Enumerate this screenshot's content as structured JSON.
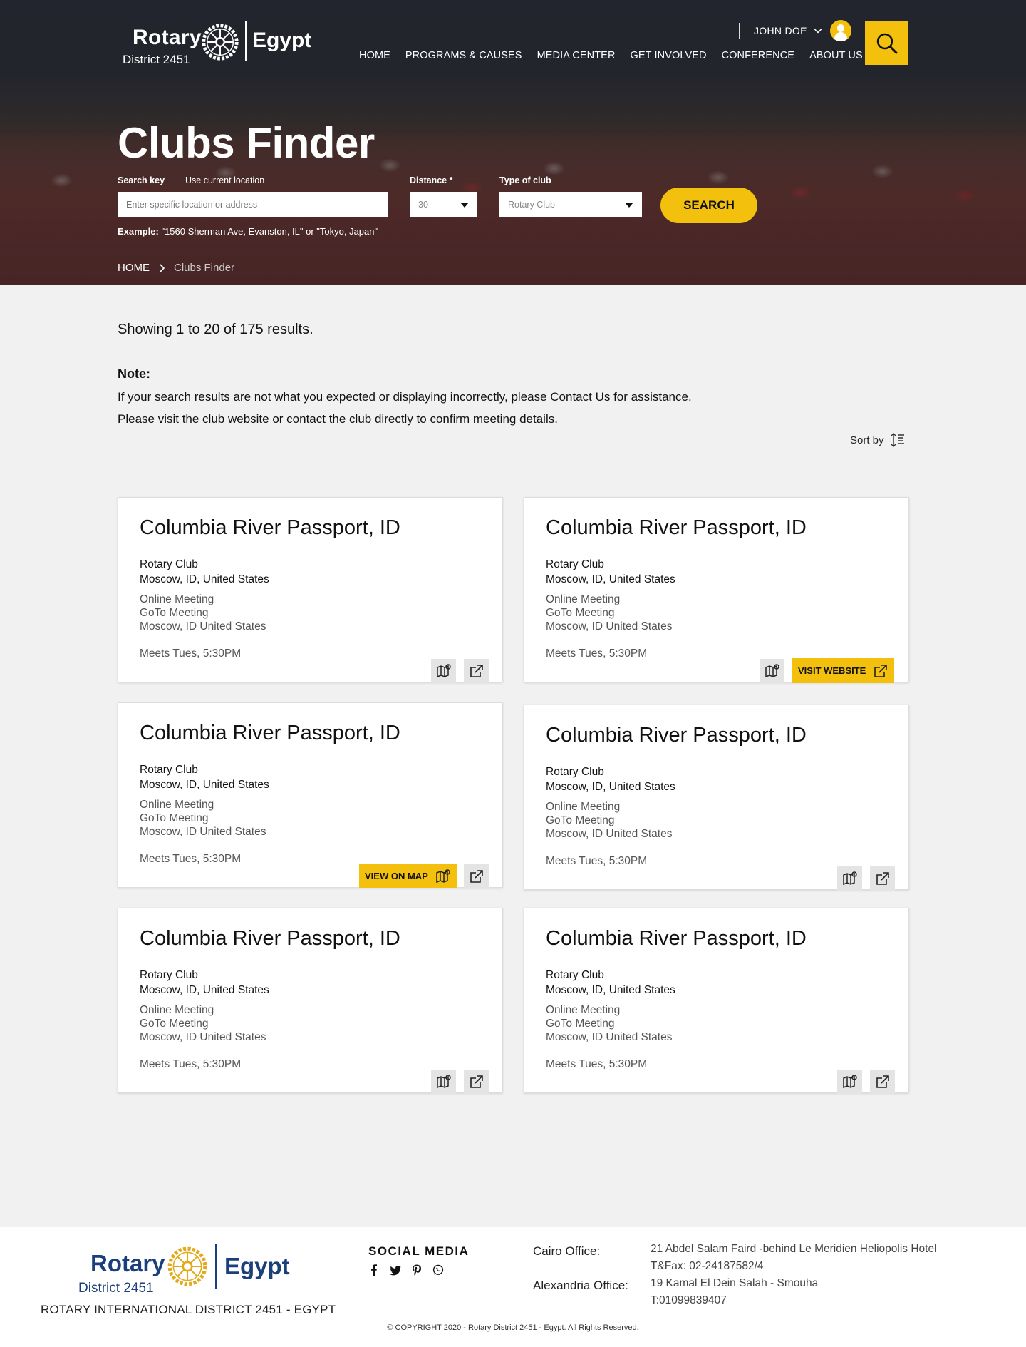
{
  "header": {
    "logo": {
      "rotary": "Rotary",
      "district": "District 2451",
      "country": "Egypt"
    },
    "user_name": "JOHN DOE",
    "nav": [
      "HOME",
      "PROGRAMS & CAUSES",
      "MEDIA CENTER",
      "GET INVOLVED",
      "CONFERENCE",
      "ABOUT US"
    ]
  },
  "hero": {
    "title": "Clubs Finder",
    "search_key_label": "Search key",
    "use_location_label": "Use current location",
    "search_placeholder": "Enter specific location or address",
    "distance_label": "Distance *",
    "distance_value": "30",
    "type_label": "Type of club",
    "type_value": "Rotary Club",
    "search_button": "SEARCH",
    "example_label": "Example:",
    "example_text": "\"1560 Sherman Ave, Evanston, IL\" or \"Tokyo, Japan\""
  },
  "breadcrumb": {
    "home": "HOME",
    "current": "Clubs Finder"
  },
  "results": {
    "showing": "Showing 1 to 20 of 175 results.",
    "note_title": "Note:",
    "note_line1": "If your search results are not what you expected or displaying incorrectly, please Contact Us for assistance.",
    "note_line2": "Please visit the club website or contact the club directly to confirm meeting details.",
    "sort_label": "Sort by"
  },
  "cards": [
    {
      "name": "Columbia River Passport, ID",
      "type": "Rotary Club",
      "location": "Moscow, ID, United States",
      "meeting1": "Online Meeting",
      "meeting2": "GoTo Meeting",
      "meeting3": "Moscow, ID United States",
      "meets": "Meets Tues, 5:30PM"
    },
    {
      "name": "Columbia River Passport, ID",
      "type": "Rotary Club",
      "location": "Moscow, ID, United States",
      "meeting1": "Online Meeting",
      "meeting2": "GoTo Meeting",
      "meeting3": "Moscow, ID United States",
      "meets": "Meets Tues, 5:30PM",
      "visit_label": "VISIT WEBSITE"
    },
    {
      "name": "Columbia River Passport, ID",
      "type": "Rotary Club",
      "location": "Moscow, ID, United States",
      "meeting1": "Online Meeting",
      "meeting2": "GoTo Meeting",
      "meeting3": "Moscow, ID United States",
      "meets": "Meets Tues, 5:30PM",
      "map_label": "VIEW ON MAP"
    },
    {
      "name": "Columbia River Passport, ID",
      "type": "Rotary Club",
      "location": "Moscow, ID, United States",
      "meeting1": "Online Meeting",
      "meeting2": "GoTo Meeting",
      "meeting3": "Moscow, ID United States",
      "meets": "Meets Tues, 5:30PM"
    },
    {
      "name": "Columbia River Passport, ID",
      "type": "Rotary Club",
      "location": "Moscow, ID, United States",
      "meeting1": "Online Meeting",
      "meeting2": "GoTo Meeting",
      "meeting3": "Moscow, ID United States",
      "meets": "Meets Tues, 5:30PM"
    },
    {
      "name": "Columbia River Passport, ID",
      "type": "Rotary Club",
      "location": "Moscow, ID, United States",
      "meeting1": "Online Meeting",
      "meeting2": "GoTo Meeting",
      "meeting3": "Moscow, ID United States",
      "meets": "Meets Tues, 5:30PM"
    }
  ],
  "footer": {
    "org_name": "ROTARY INTERNATIONAL DISTRICT 2451 - EGYPT",
    "social_title": "SOCIAL MEDIA",
    "social_icons": [
      "facebook-icon",
      "twitter-icon",
      "pinterest-icon",
      "whatsapp-icon"
    ],
    "cairo_label": "Cairo Office:",
    "cairo_address": "21 Abdel Salam Faird -behind Le Meridien Heliopolis Hotel",
    "cairo_phone": "T&Fax: 02-24187582/4",
    "alex_label": "Alexandria Office:",
    "alex_address": "19 Kamal El Dein Salah - Smouha",
    "alex_phone": "T:01099839407",
    "copyright": "© COPYRIGHT 2020 - Rotary District 2451 - Egypt. All Rights Reserved."
  },
  "colors": {
    "accent": "#f3c10d",
    "brand_blue": "#1a3f7a",
    "page_bg": "#f1f1f1"
  }
}
